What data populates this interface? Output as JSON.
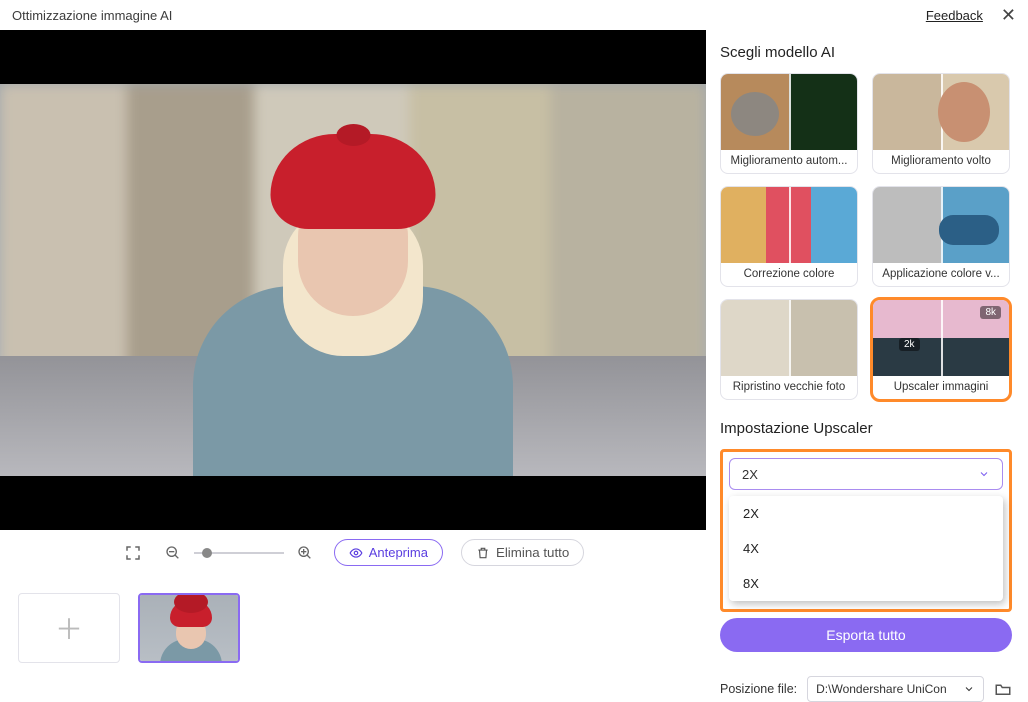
{
  "window": {
    "title": "Ottimizzazione immagine AI"
  },
  "header": {
    "feedback_label": "Feedback"
  },
  "side": {
    "models_heading": "Scegli modello AI",
    "models": [
      {
        "label": "Miglioramento autom...",
        "selected": false
      },
      {
        "label": "Miglioramento volto",
        "selected": false
      },
      {
        "label": "Correzione colore",
        "selected": false
      },
      {
        "label": "Applicazione colore v...",
        "selected": false
      },
      {
        "label": "Ripristino vecchie foto",
        "selected": false
      },
      {
        "label": "Upscaler immagini",
        "selected": true
      }
    ],
    "upscaler_heading": "Impostazione Upscaler",
    "upscaler_tag_high": "8k",
    "upscaler_tag_low": "2k",
    "upscale_select_value": "2X",
    "upscale_options": [
      "2X",
      "4X",
      "8X"
    ],
    "export_all_label": "Esporta tutto",
    "location_label": "Posizione file:",
    "location_value": "D:\\Wondershare UniCon"
  },
  "controls": {
    "preview_label": "Anteprima",
    "delete_all_label": "Elimina tutto"
  }
}
